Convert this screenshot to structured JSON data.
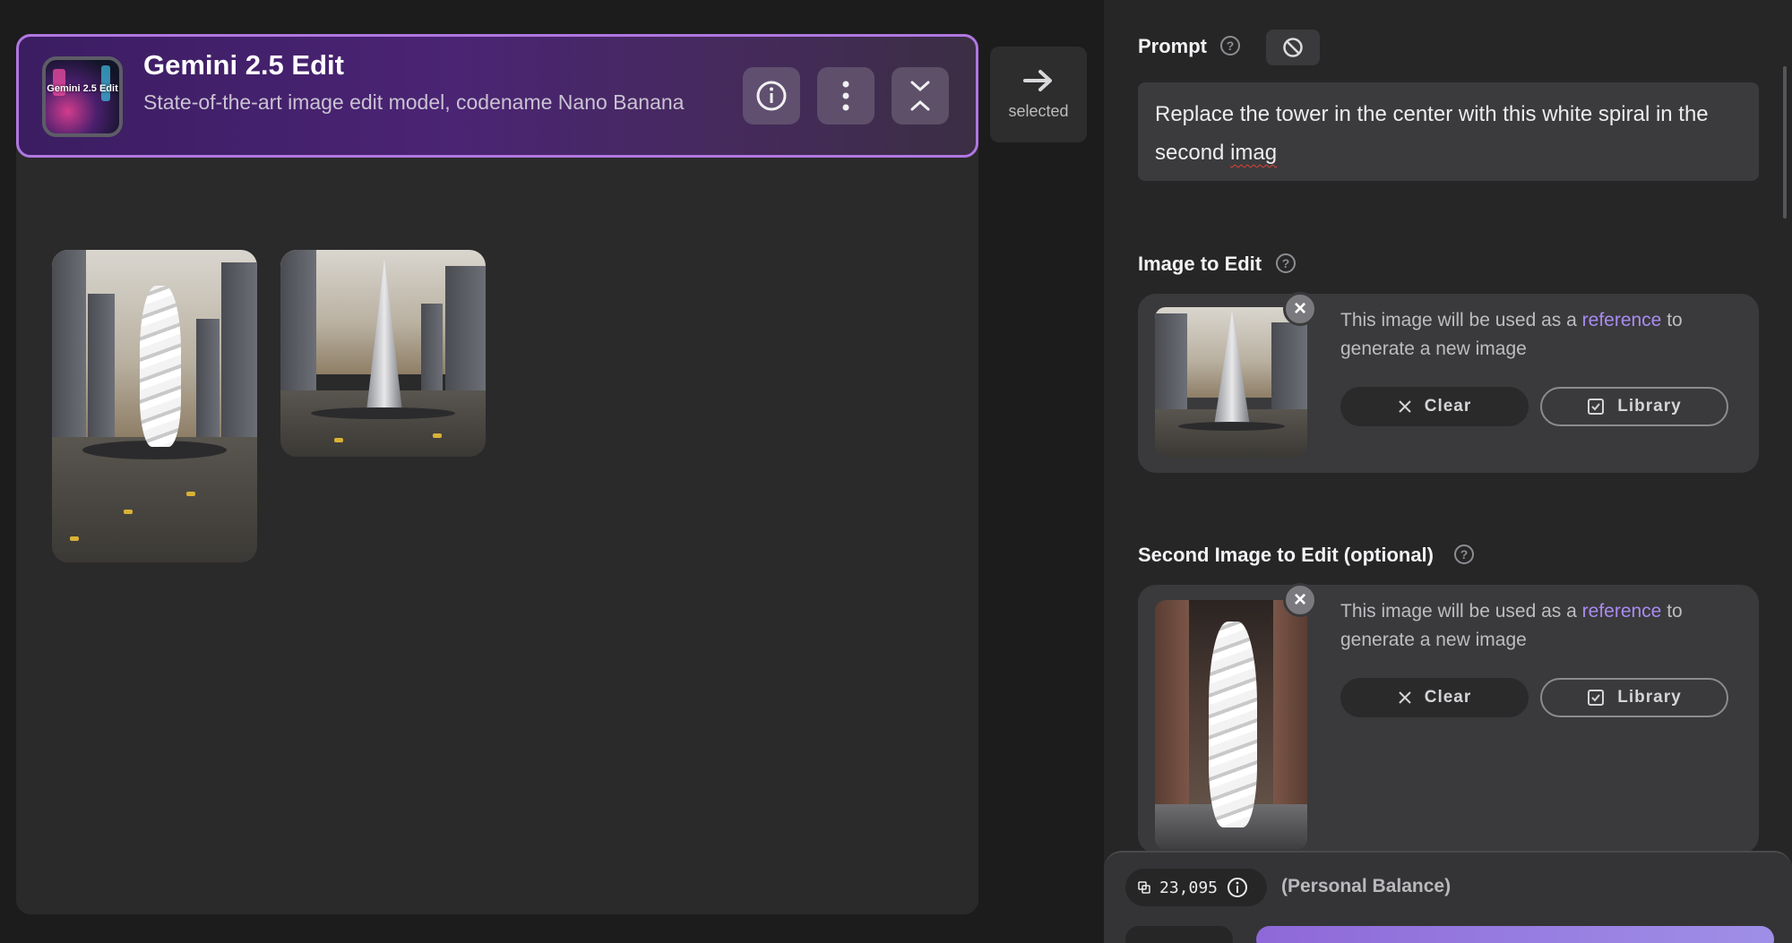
{
  "model": {
    "title": "Gemini 2.5 Edit",
    "description": "State-of-the-art image edit model, codename Nano Banana",
    "thumb_text": "Gemini 2.5 Edit"
  },
  "selected_label": "selected",
  "prompt": {
    "label": "Prompt",
    "text_main": "Replace the tower in the center with this white spiral in the second ",
    "text_misspelled": "imag"
  },
  "image_to_edit": {
    "label": "Image to Edit",
    "ref_prefix": "This image will be used as a ",
    "ref_link": "reference",
    "ref_suffix": " to generate a new image",
    "clear_label": "Clear",
    "library_label": "Library"
  },
  "second_image": {
    "label": "Second Image to Edit (optional)",
    "ref_prefix": "This image will be used as a ",
    "ref_link": "reference",
    "ref_suffix": " to generate a new image",
    "clear_label": "Clear",
    "library_label": "Library"
  },
  "balance": {
    "amount": "23,095",
    "label": "(Personal Balance)"
  },
  "colors": {
    "accent": "#b077e0",
    "link": "#a98bf0",
    "background": "#1c1c1d"
  }
}
